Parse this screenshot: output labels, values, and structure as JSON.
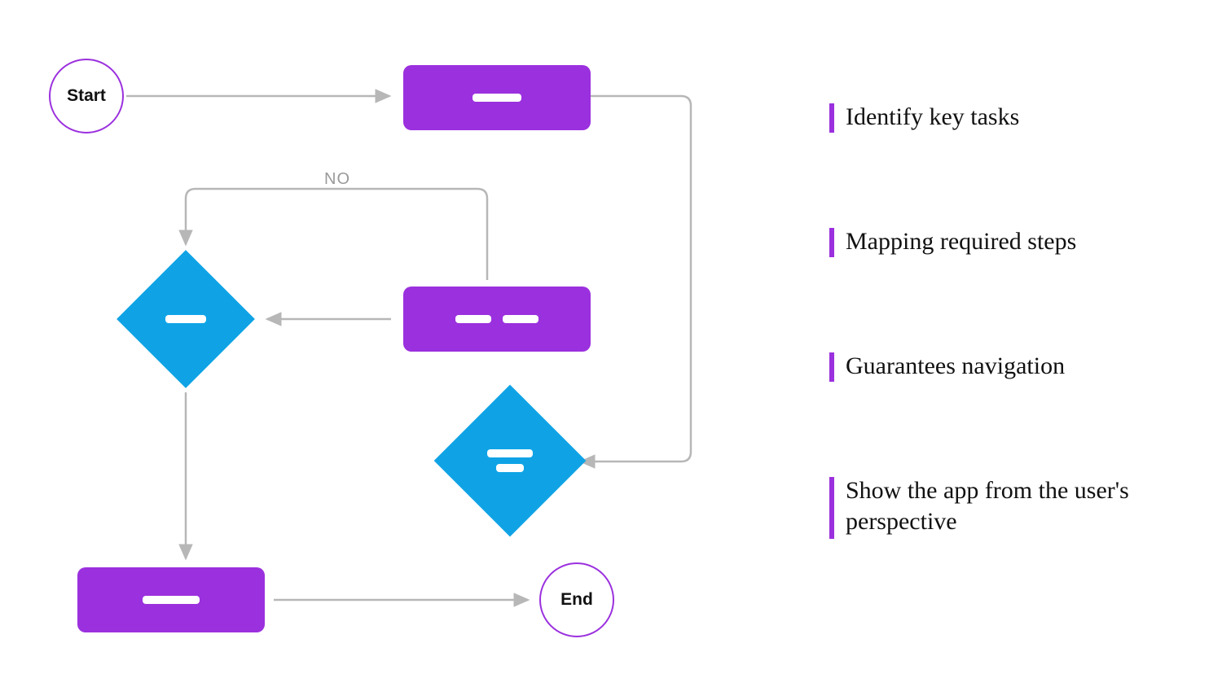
{
  "flowchart": {
    "start_label": "Start",
    "end_label": "End",
    "no_label": "NO"
  },
  "sidebar": {
    "items": [
      {
        "text": "Identify key tasks"
      },
      {
        "text": "Mapping required steps"
      },
      {
        "text": "Guarantees navigation"
      },
      {
        "text": "Show the app from the user's perspective"
      }
    ]
  },
  "colors": {
    "purple": "#9B30DE",
    "blue": "#0FA3E6",
    "arrow": "#b7b7b7"
  }
}
